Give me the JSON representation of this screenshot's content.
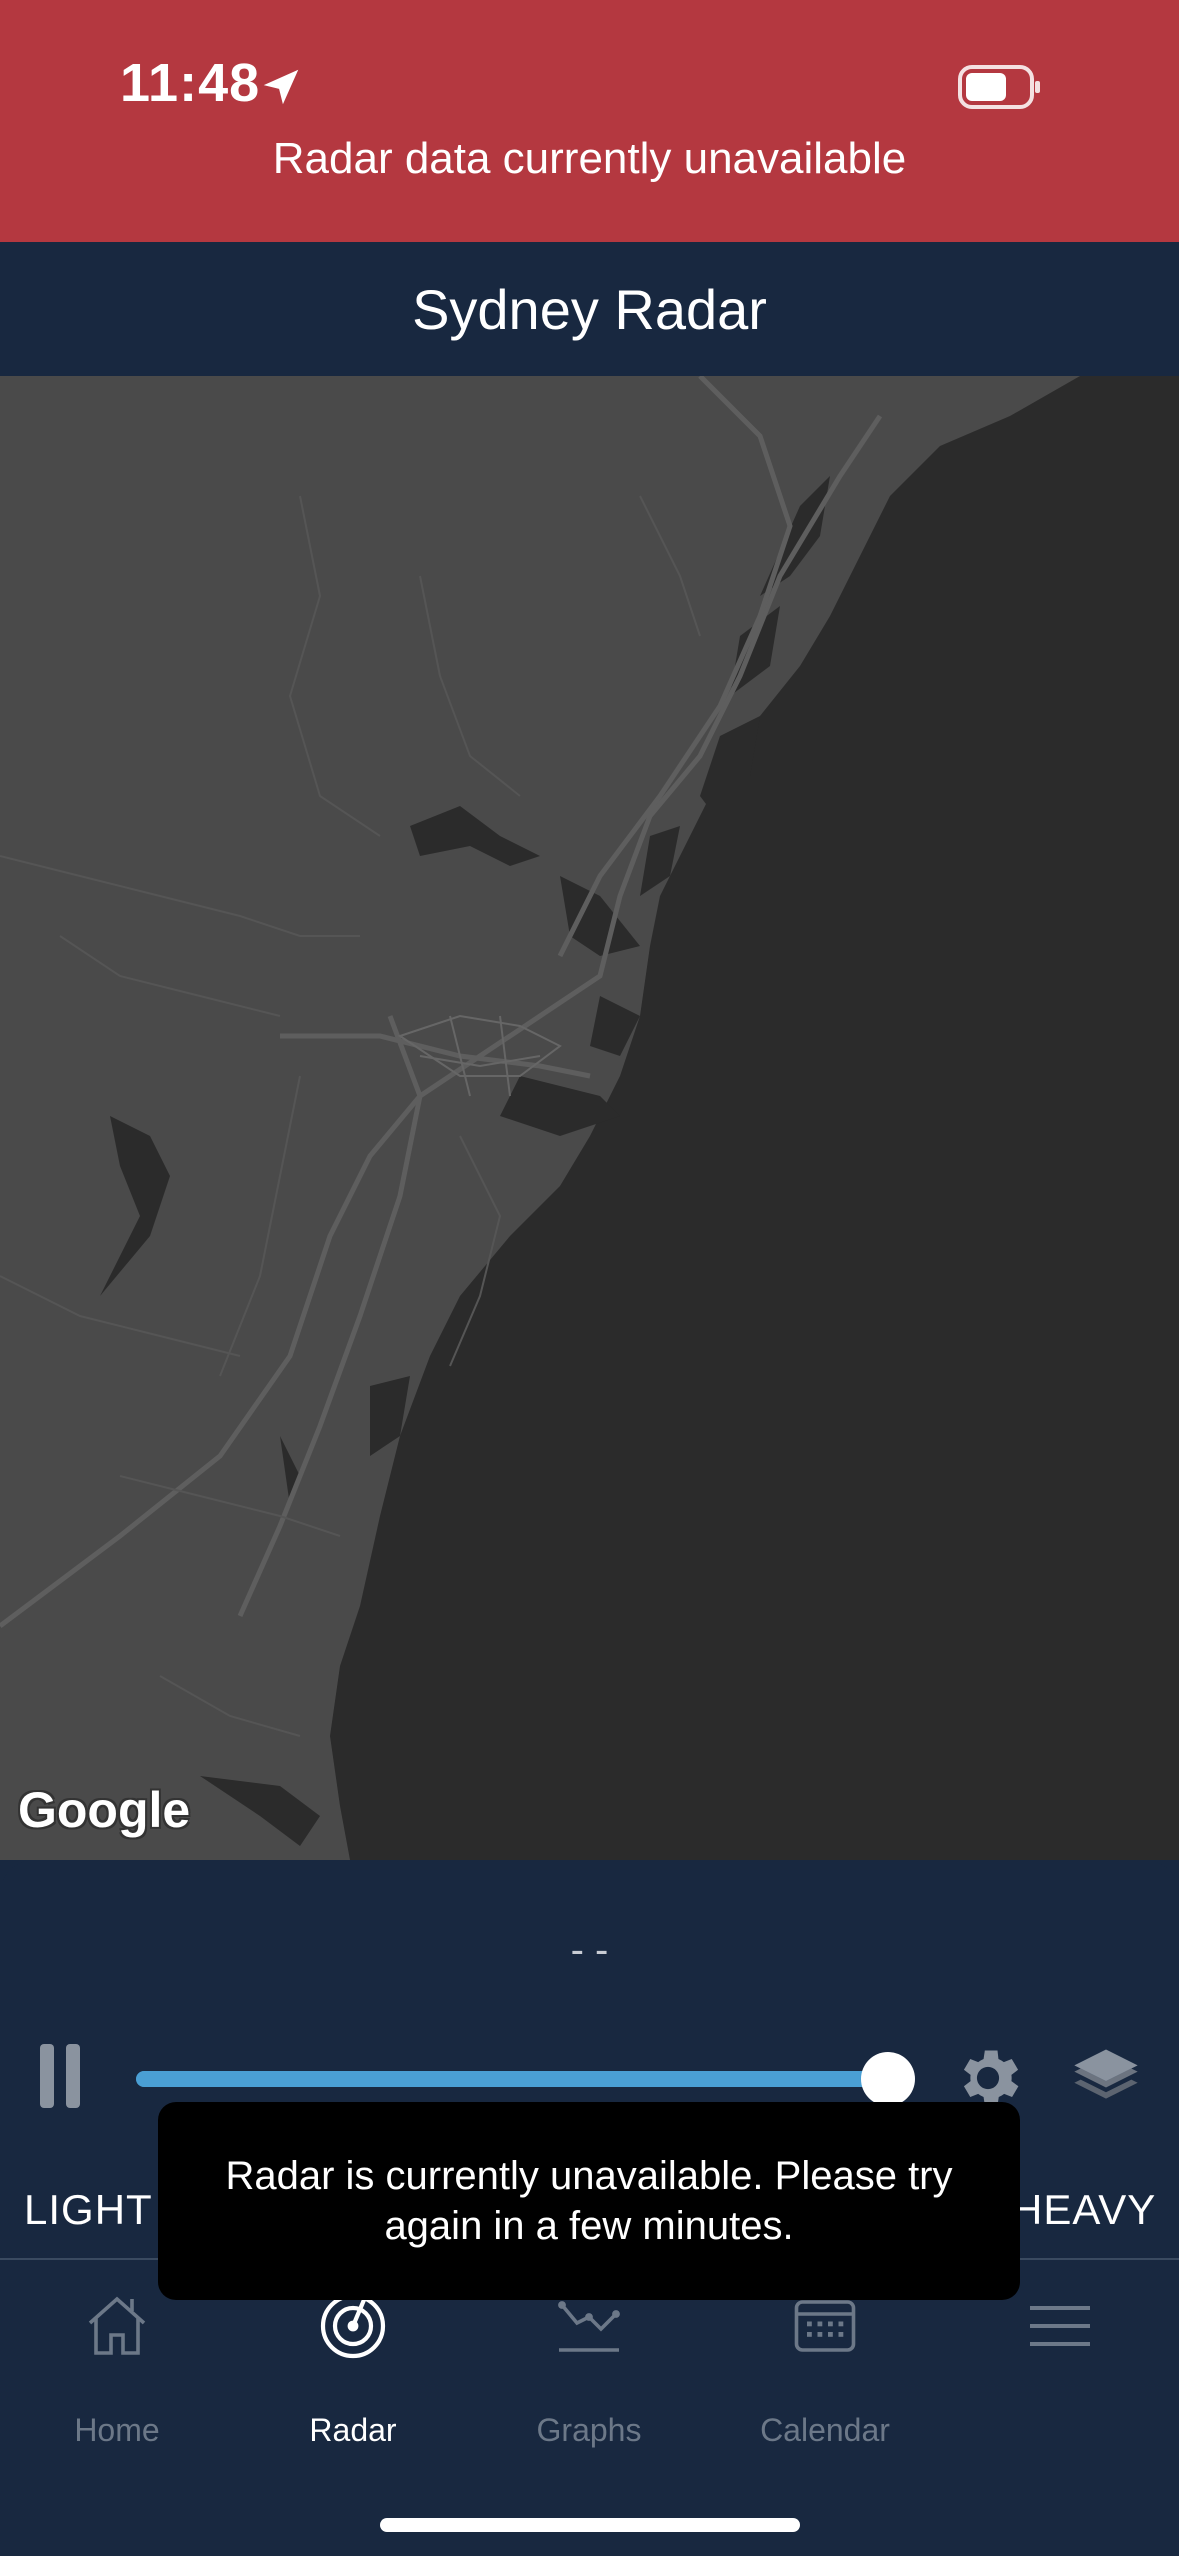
{
  "status_bar": {
    "time": "11:48",
    "location_icon": "location-arrow-icon",
    "battery_icon": "battery-icon",
    "background": "#b43840"
  },
  "alert": {
    "text": "Radar data currently unavailable"
  },
  "header": {
    "title": "Sydney Radar",
    "background": "#182840"
  },
  "map": {
    "attribution": "Google",
    "land_color": "#4a4a4a",
    "water_color": "#2b2b2b"
  },
  "controls": {
    "timestamp": "- -",
    "pause_icon": "pause-icon",
    "slider_value": 1.0,
    "settings_icon": "gear-icon",
    "layers_icon": "layers-icon",
    "accent": "#4a9fd4"
  },
  "legend": {
    "light": "LIGHT",
    "heavy": "HEAVY"
  },
  "toast": {
    "message": "Radar is currently unavailable.  Please try again in a few minutes."
  },
  "tabs": [
    {
      "label": "Home",
      "icon": "home-icon",
      "active": false
    },
    {
      "label": "Radar",
      "icon": "radar-icon",
      "active": true
    },
    {
      "label": "Graphs",
      "icon": "graph-icon",
      "active": false
    },
    {
      "label": "Calendar",
      "icon": "calendar-icon",
      "active": false
    },
    {
      "label": "",
      "icon": "menu-icon",
      "active": false
    }
  ]
}
